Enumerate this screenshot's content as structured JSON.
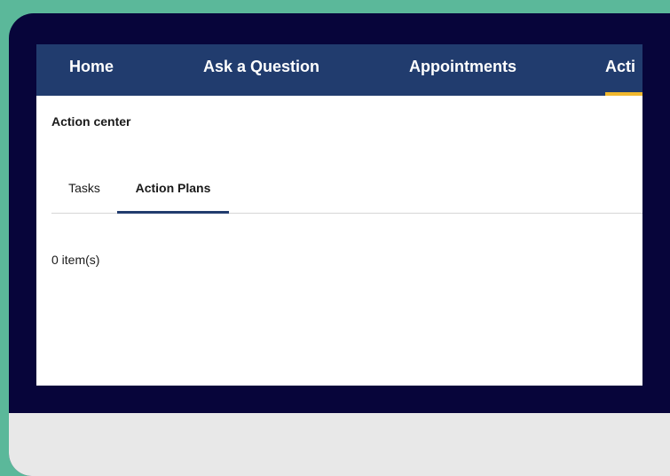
{
  "nav": {
    "items": [
      {
        "label": "Home"
      },
      {
        "label": "Ask a Question"
      },
      {
        "label": "Appointments"
      },
      {
        "label": "Acti"
      }
    ],
    "accent_color": "#f1b82d",
    "background_color": "#213c6e"
  },
  "page": {
    "breadcrumb": "Action center"
  },
  "tabs": [
    {
      "label": "Tasks"
    },
    {
      "label": "Action Plans"
    }
  ],
  "content": {
    "item_count": "0 item(s)"
  },
  "colors": {
    "frame": "#07053a",
    "background": "#5bb89a",
    "chin": "#e8e8e8"
  }
}
